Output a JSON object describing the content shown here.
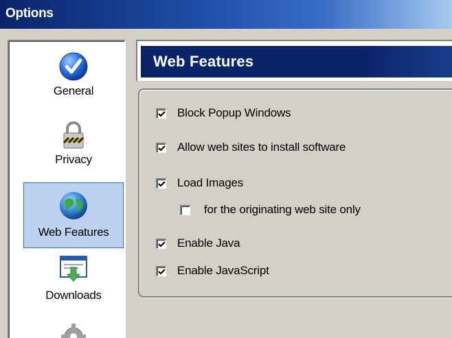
{
  "window": {
    "title": "Options"
  },
  "sidebar": {
    "items": [
      {
        "label": "General",
        "icon": "check-circle-icon",
        "selected": false
      },
      {
        "label": "Privacy",
        "icon": "padlock-icon",
        "selected": false
      },
      {
        "label": "Web Features",
        "icon": "globe-icon",
        "selected": true
      },
      {
        "label": "Downloads",
        "icon": "download-window-icon",
        "selected": false
      },
      {
        "label": "",
        "icon": "gear-icon",
        "selected": false
      }
    ]
  },
  "panel": {
    "title": "Web Features",
    "options": [
      {
        "label": "Block Popup Windows",
        "checked": true
      },
      {
        "label": "Allow web sites to install software",
        "checked": true
      },
      {
        "label": "Load Images",
        "checked": true
      },
      {
        "label": "for the originating web site only",
        "checked": false
      },
      {
        "label": "Enable Java",
        "checked": true
      },
      {
        "label": "Enable JavaScript",
        "checked": true
      }
    ]
  },
  "colors": {
    "titlebar_start": "#0a246a",
    "titlebar_end": "#a6caf0",
    "selection_fill": "#bcd2ee",
    "face": "#d4d0c8"
  }
}
